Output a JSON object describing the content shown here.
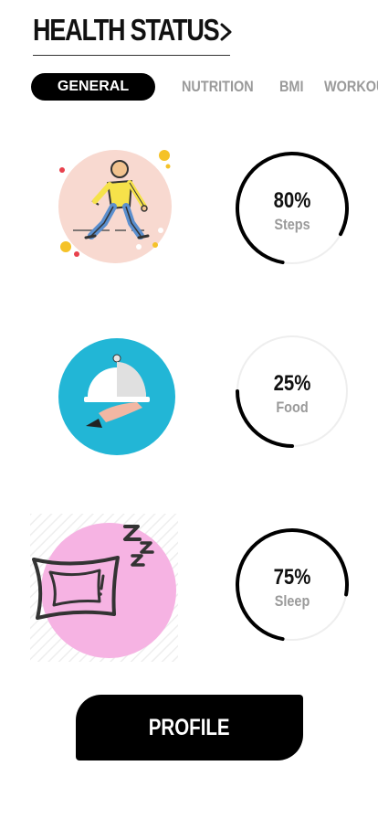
{
  "header": {
    "title": "HEALTH STATUS"
  },
  "tabs": [
    {
      "label": "GENERAL",
      "active": true
    },
    {
      "label": "NUTRITION",
      "active": false
    },
    {
      "label": "BMI",
      "active": false
    },
    {
      "label": "WORKOUT",
      "active": false
    }
  ],
  "stats": [
    {
      "percent": "80%",
      "label": "Steps",
      "value": 0.8,
      "icon": "walking-person-icon"
    },
    {
      "percent": "25%",
      "label": "Food",
      "value": 0.25,
      "icon": "food-cloche-icon"
    },
    {
      "percent": "75%",
      "label": "Sleep",
      "value": 0.75,
      "icon": "sleep-pillow-icon"
    }
  ],
  "profile_button": {
    "label": "PROFILE"
  },
  "colors": {
    "accent": "#000000",
    "ring_track": "#eeeeee",
    "steps_bg": "#f8d9d0",
    "food_bg": "#22b6d6",
    "sleep_bg": "#f6b3e3"
  }
}
